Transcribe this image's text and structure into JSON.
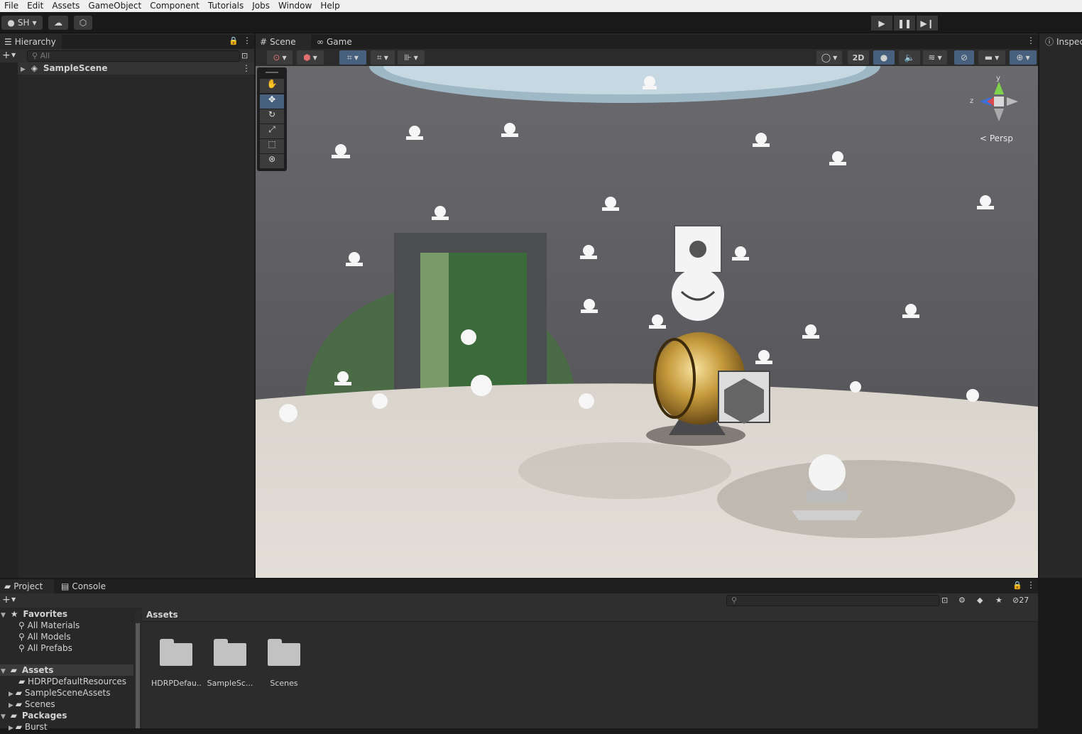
{
  "menu": [
    "File",
    "Edit",
    "Assets",
    "GameObject",
    "Component",
    "Tutorials",
    "Jobs",
    "Window",
    "Help"
  ],
  "toolbar": {
    "account_label": "SH",
    "play_icon": "play-icon",
    "pause_icon": "pause-icon",
    "step_icon": "step-icon"
  },
  "hierarchy": {
    "tab_label": "Hierarchy",
    "search_placeholder": "All",
    "root_item": "SampleScene"
  },
  "scene_view": {
    "tabs": [
      "Scene",
      "Game"
    ],
    "toggle_2d": "2D",
    "projection_label": "< Persp",
    "axis_labels": {
      "y": "y",
      "z": "z"
    }
  },
  "inspector": {
    "tab_label": "Inspec"
  },
  "project": {
    "tabs": [
      "Project",
      "Console"
    ],
    "hidden_count": "27",
    "favorites_label": "Favorites",
    "favorites": [
      "All Materials",
      "All Models",
      "All Prefabs"
    ],
    "assets_label": "Assets",
    "asset_folders": [
      "HDRPDefaultResources",
      "SampleSceneAssets",
      "Scenes"
    ],
    "packages_label": "Packages",
    "packages": [
      "Burst"
    ],
    "breadcrumb": "Assets",
    "grid_items": [
      "HDRPDefau...",
      "SampleSc...",
      "Scenes"
    ]
  },
  "colors": {
    "accent_selected": "#46607e",
    "panel_bg": "#282828",
    "background": "#191919"
  }
}
